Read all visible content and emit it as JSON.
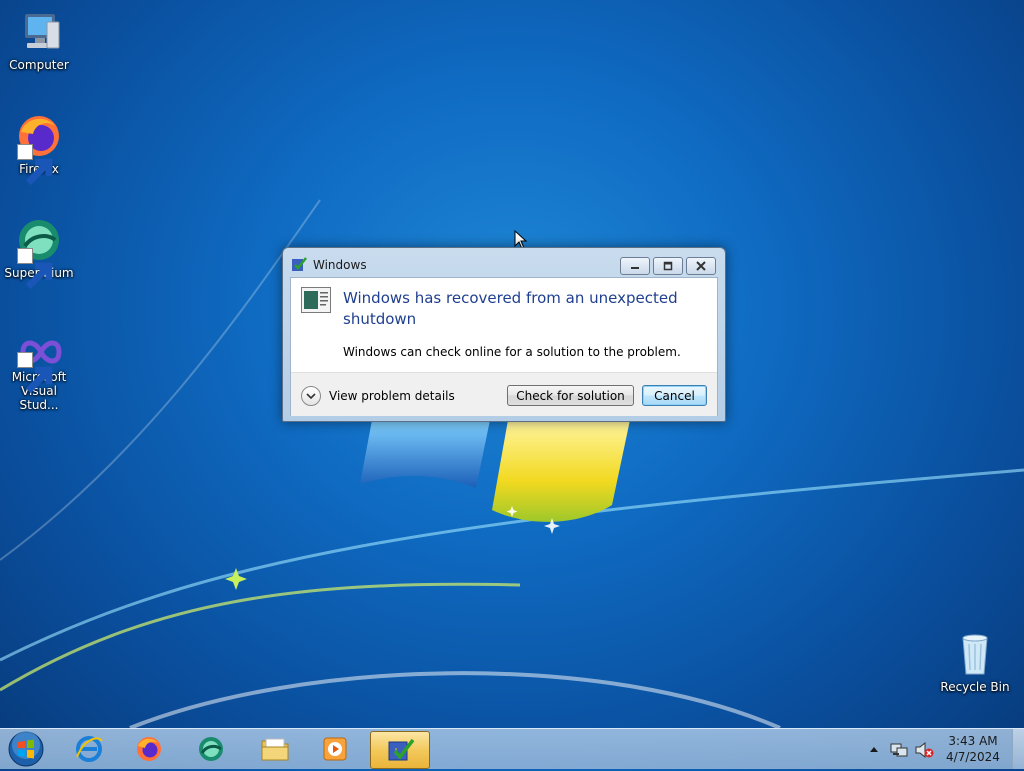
{
  "desktop": {
    "icons": [
      {
        "label": "Computer"
      },
      {
        "label": "Firefox"
      },
      {
        "label": "Supermium"
      },
      {
        "label": "Microsoft Visual Stud..."
      },
      {
        "label": "Recycle Bin"
      }
    ]
  },
  "dialog": {
    "title": "Windows",
    "heading": "Windows has recovered from an unexpected shutdown",
    "message": "Windows can check online for a solution to the problem.",
    "details_label": "View problem details",
    "check_button": "Check for solution",
    "cancel_button": "Cancel"
  },
  "taskbar": {
    "pinned": [
      "start-orb",
      "internet-explorer",
      "firefox",
      "supermium",
      "file-explorer",
      "media-player",
      "problem-reporting"
    ],
    "active": "problem-reporting"
  },
  "tray": {
    "time": "3:43 AM",
    "date": "4/7/2024"
  },
  "colors": {
    "heading": "#1f3f8f",
    "desktop_bg": "#0f6bc2"
  }
}
